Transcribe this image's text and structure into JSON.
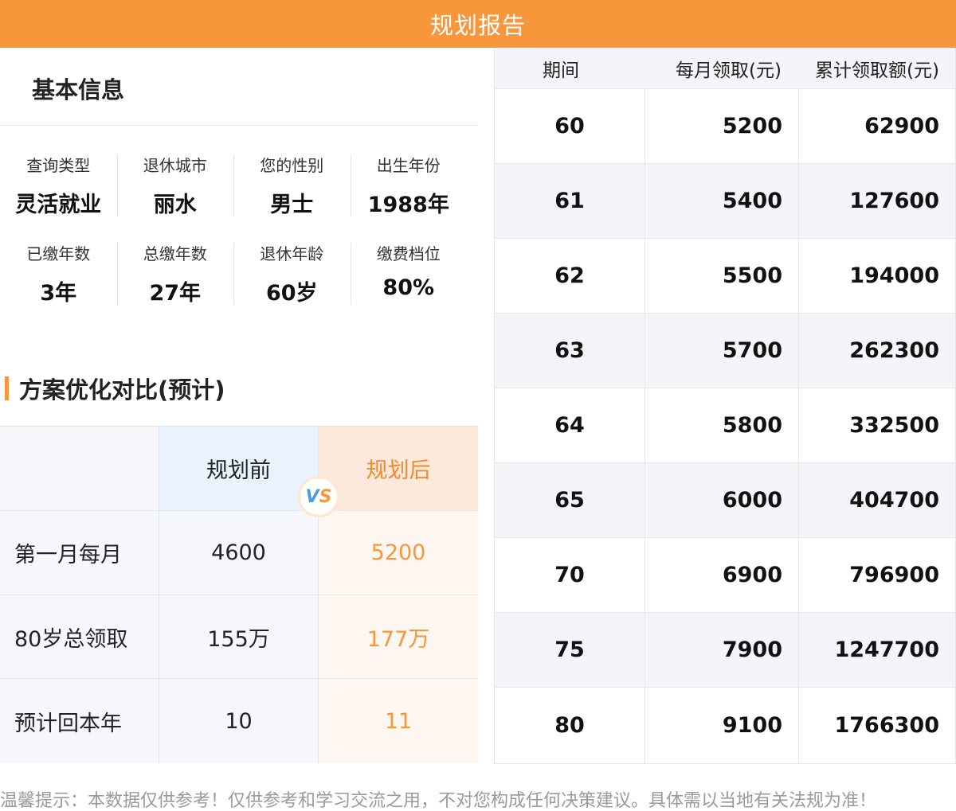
{
  "header": {
    "title": "规划报告"
  },
  "basic_info": {
    "title": "基本信息",
    "items": [
      {
        "label": "查询类型",
        "value": "灵活就业"
      },
      {
        "label": "退休城市",
        "value": "丽水"
      },
      {
        "label": "您的性别",
        "value": "男士"
      },
      {
        "label": "出生年份",
        "value": "1988年"
      },
      {
        "label": "已缴年数",
        "value": "3年"
      },
      {
        "label": "总缴年数",
        "value": "27年"
      },
      {
        "label": "退休年龄",
        "value": "60岁"
      },
      {
        "label": "缴费档位",
        "value": "80%"
      }
    ]
  },
  "comparison": {
    "title": "方案优化对比(预计)",
    "before_label": "规划前",
    "after_label": "规划后",
    "vs": {
      "v": "V",
      "s": "S"
    },
    "rows": [
      {
        "label": "第一月每月",
        "before": "4600",
        "after": "5200"
      },
      {
        "label": "80岁总领取",
        "before": "155万",
        "after": "177万"
      },
      {
        "label": "预计回本年",
        "before": "10",
        "after": "11"
      }
    ]
  },
  "schedule": {
    "headers": [
      "期间",
      "每月领取(元)",
      "累计领取额(元)"
    ],
    "rows": [
      {
        "period": "60",
        "monthly": "5200",
        "cumulative": "62900"
      },
      {
        "period": "61",
        "monthly": "5400",
        "cumulative": "127600"
      },
      {
        "period": "62",
        "monthly": "5500",
        "cumulative": "194000"
      },
      {
        "period": "63",
        "monthly": "5700",
        "cumulative": "262300"
      },
      {
        "period": "64",
        "monthly": "5800",
        "cumulative": "332500"
      },
      {
        "period": "65",
        "monthly": "6000",
        "cumulative": "404700"
      },
      {
        "period": "70",
        "monthly": "6900",
        "cumulative": "796900"
      },
      {
        "period": "75",
        "monthly": "7900",
        "cumulative": "1247700"
      },
      {
        "period": "80",
        "monthly": "9100",
        "cumulative": "1766300"
      }
    ]
  },
  "footer": {
    "disclaimer": "温馨提示：本数据仅供参考！仅供参考和学习交流之用，不对您构成任何决策建议。具体需以当地有关法规为准！"
  },
  "colors": {
    "accent": "#f7963a",
    "vs_blue": "#4a9be6"
  }
}
